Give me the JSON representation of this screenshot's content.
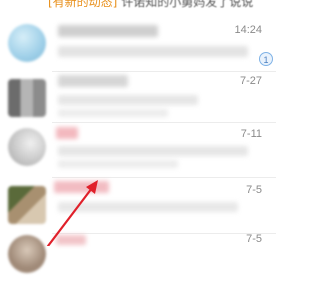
{
  "top_snippet": {
    "tag": "[有新的动态]",
    "rest": " 许诺知的小舅妈发了说说"
  },
  "chats": [
    {
      "time": "14:24",
      "avatar_color": "#9ecfe8"
    },
    {
      "time": "7-27",
      "avatar_color": "#8a8a8a"
    },
    {
      "time": "7-11",
      "avatar_color": "#c8c8c8"
    },
    {
      "time": "7-5",
      "avatar_color": "#7a8a5a"
    },
    {
      "time": "7-5",
      "avatar_color": "#a08a78"
    }
  ],
  "badge_label": "1",
  "annotation": {
    "type": "arrow",
    "color": "#e0202a"
  },
  "colors": {
    "snippet_tag": "#e8901c",
    "divider": "#ececec",
    "time_text": "#8a8a8a"
  }
}
